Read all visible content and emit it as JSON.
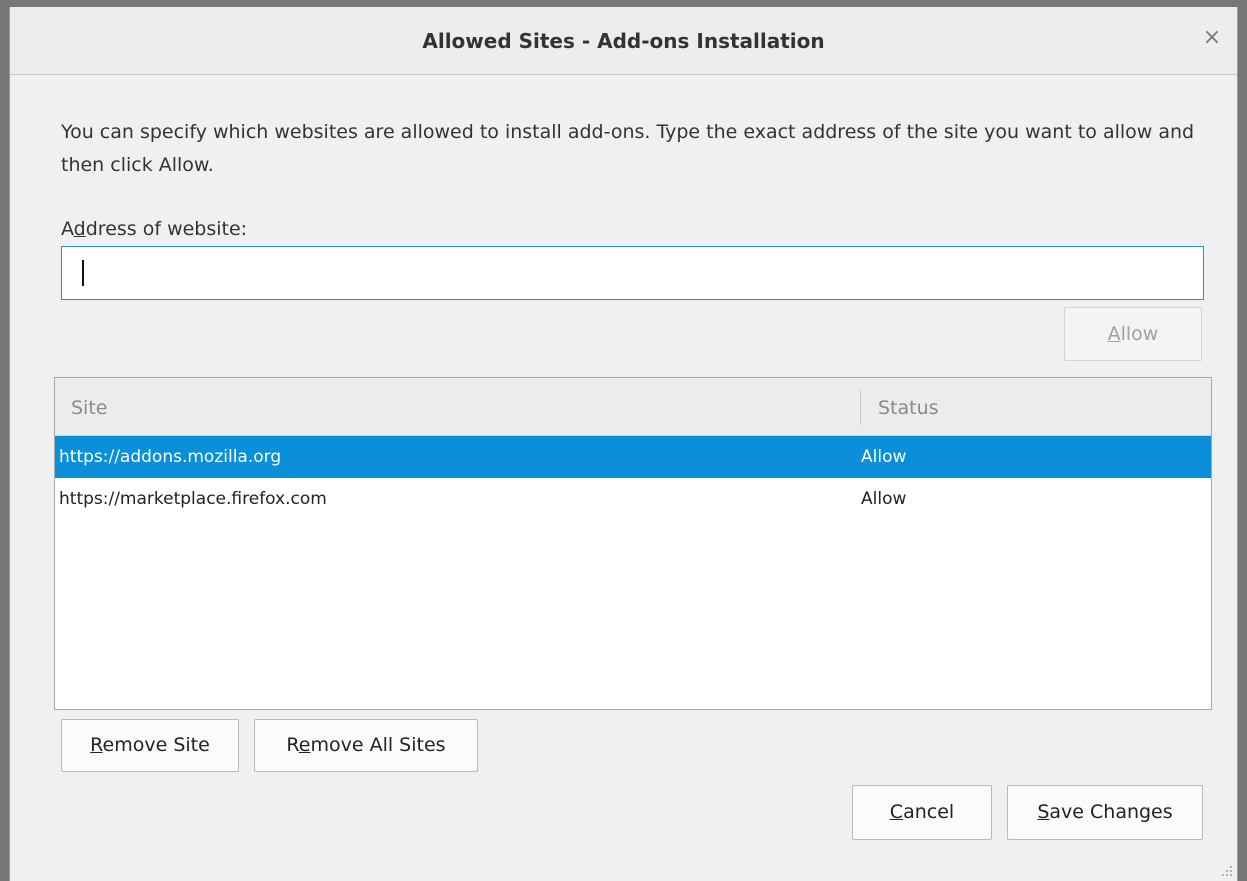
{
  "dialog": {
    "title": "Allowed Sites - Add-ons Installation",
    "close_glyph": "×",
    "description": "You can specify which websites are allowed to install add-ons. Type the exact address of the site you want to allow and then click Allow."
  },
  "address": {
    "label_pre": "A",
    "label_mnemonic": "d",
    "label_post": "dress of website:",
    "value": ""
  },
  "allow_button": {
    "mnemonic": "A",
    "rest": "llow",
    "enabled": false
  },
  "table": {
    "columns": [
      "Site",
      "Status"
    ],
    "rows": [
      {
        "site": "https://addons.mozilla.org",
        "status": "Allow",
        "selected": true
      },
      {
        "site": "https://marketplace.firefox.com",
        "status": "Allow",
        "selected": false
      }
    ],
    "selection_color": "#0a8fd8"
  },
  "buttons": {
    "remove_site": {
      "mnemonic": "R",
      "rest": "emove Site"
    },
    "remove_all": {
      "pre": "R",
      "mnemonic": "e",
      "rest": "move All Sites"
    },
    "cancel": {
      "mnemonic": "C",
      "rest": "ancel"
    },
    "save": {
      "mnemonic": "S",
      "rest": "ave Changes"
    }
  },
  "icons": {
    "close": "close-icon",
    "resize": "resize-grip-icon"
  }
}
